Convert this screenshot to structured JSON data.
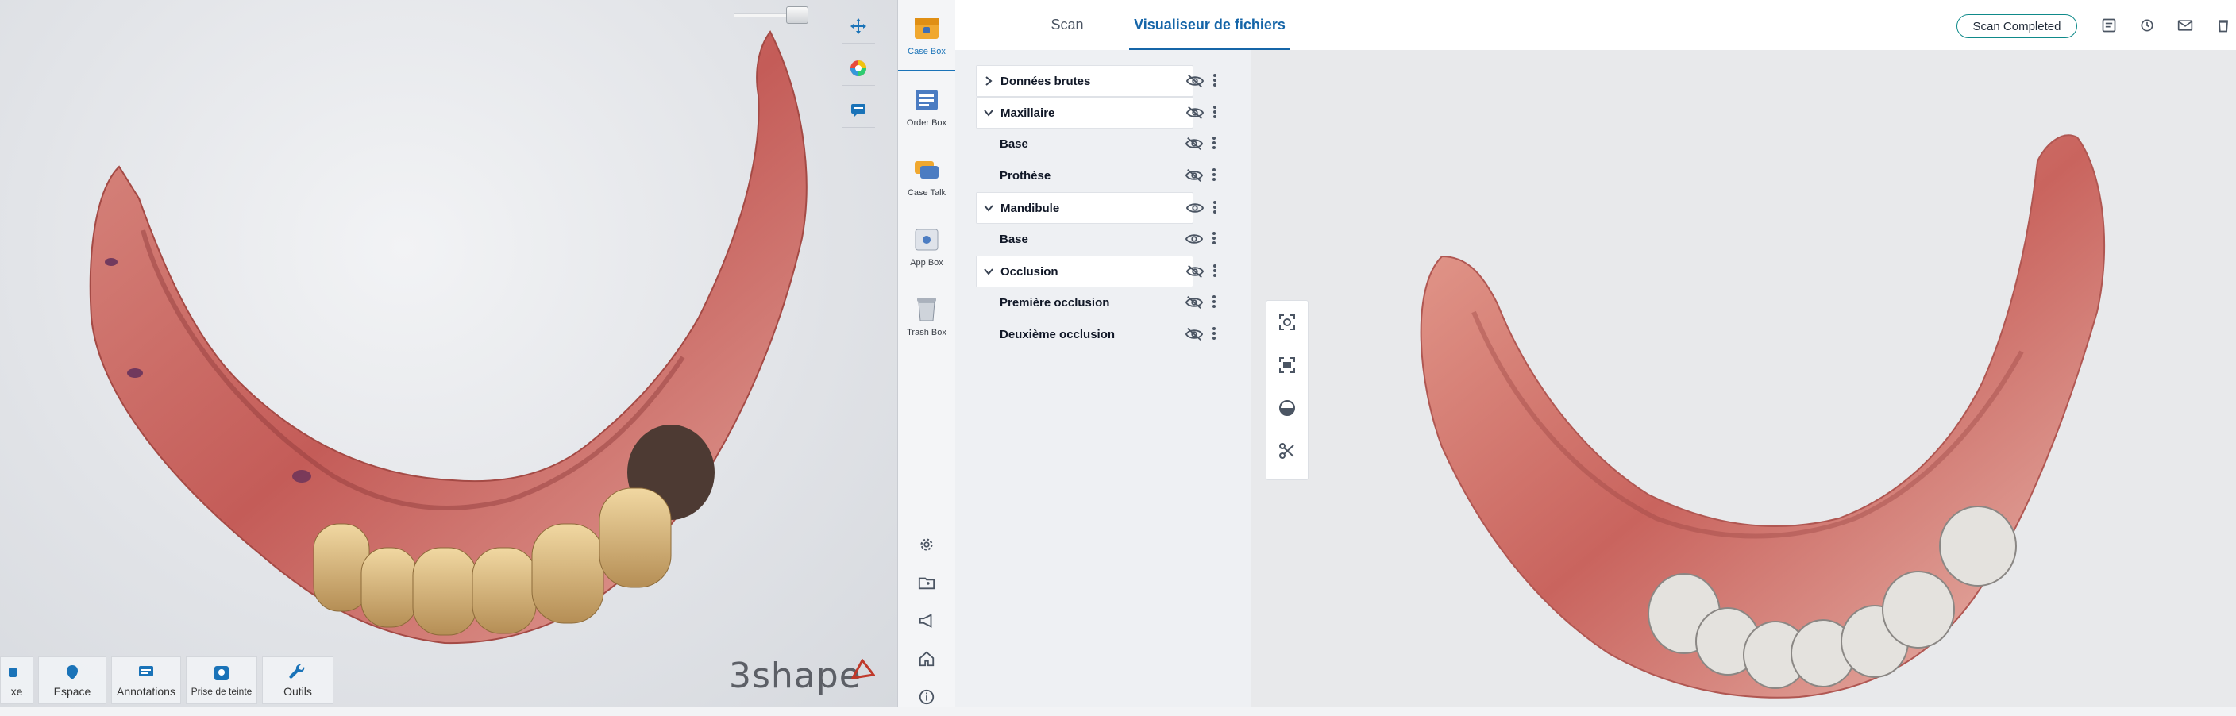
{
  "header": {
    "tabs": [
      {
        "label": "Scan",
        "active": false
      },
      {
        "label": "Visualiseur de fichiers",
        "active": true
      }
    ],
    "status": "Scan Completed",
    "icons": [
      "notes-icon",
      "history-icon",
      "mail-icon",
      "trash-icon"
    ]
  },
  "nav": {
    "items": [
      {
        "label": "Case Box",
        "icon": "case-box-icon",
        "active": true
      },
      {
        "label": "Order Box",
        "icon": "order-box-icon",
        "active": false
      },
      {
        "label": "Case Talk",
        "icon": "case-talk-icon",
        "active": false
      },
      {
        "label": "App Box",
        "icon": "app-box-icon",
        "active": false
      },
      {
        "label": "Trash Box",
        "icon": "trash-box-icon",
        "active": false
      }
    ],
    "bottom_icons": [
      "settings-icon",
      "folder-user-icon",
      "megaphone-icon",
      "home-icon",
      "info-icon"
    ]
  },
  "tree": {
    "rows": [
      {
        "label": "Données brutes",
        "type": "group",
        "expanded": false,
        "visible": false
      },
      {
        "label": "Maxillaire",
        "type": "group",
        "expanded": true,
        "visible": false
      },
      {
        "label": "Base",
        "type": "child",
        "visible": false
      },
      {
        "label": "Prothèse",
        "type": "child",
        "visible": false
      },
      {
        "label": "Mandibule",
        "type": "group",
        "expanded": true,
        "visible": true
      },
      {
        "label": "Base",
        "type": "child",
        "visible": true
      },
      {
        "label": "Occlusion",
        "type": "group",
        "expanded": true,
        "visible": false
      },
      {
        "label": "Première occlusion",
        "type": "child",
        "visible": false
      },
      {
        "label": "Deuxième occlusion",
        "type": "child",
        "visible": false
      }
    ]
  },
  "left_view": {
    "toolbar": [
      {
        "label": "xe",
        "icon": "partial-tool-icon"
      },
      {
        "label": "Espace",
        "icon": "space-icon"
      },
      {
        "label": "Annotations",
        "icon": "annotation-icon"
      },
      {
        "label": "Prise de teinte",
        "icon": "shade-icon"
      },
      {
        "label": "Outils",
        "icon": "wrench-icon"
      }
    ],
    "brand": "3shape",
    "top_tools": [
      "move-icon",
      "color-wheel-icon",
      "comment-icon"
    ]
  },
  "right_view": {
    "tools": [
      "focus-icon",
      "frame-icon",
      "half-circle-icon",
      "scissors-icon"
    ]
  },
  "colors": {
    "accent": "#1565a8",
    "status_border": "#0f8a8a",
    "gum": "#c9645e"
  }
}
